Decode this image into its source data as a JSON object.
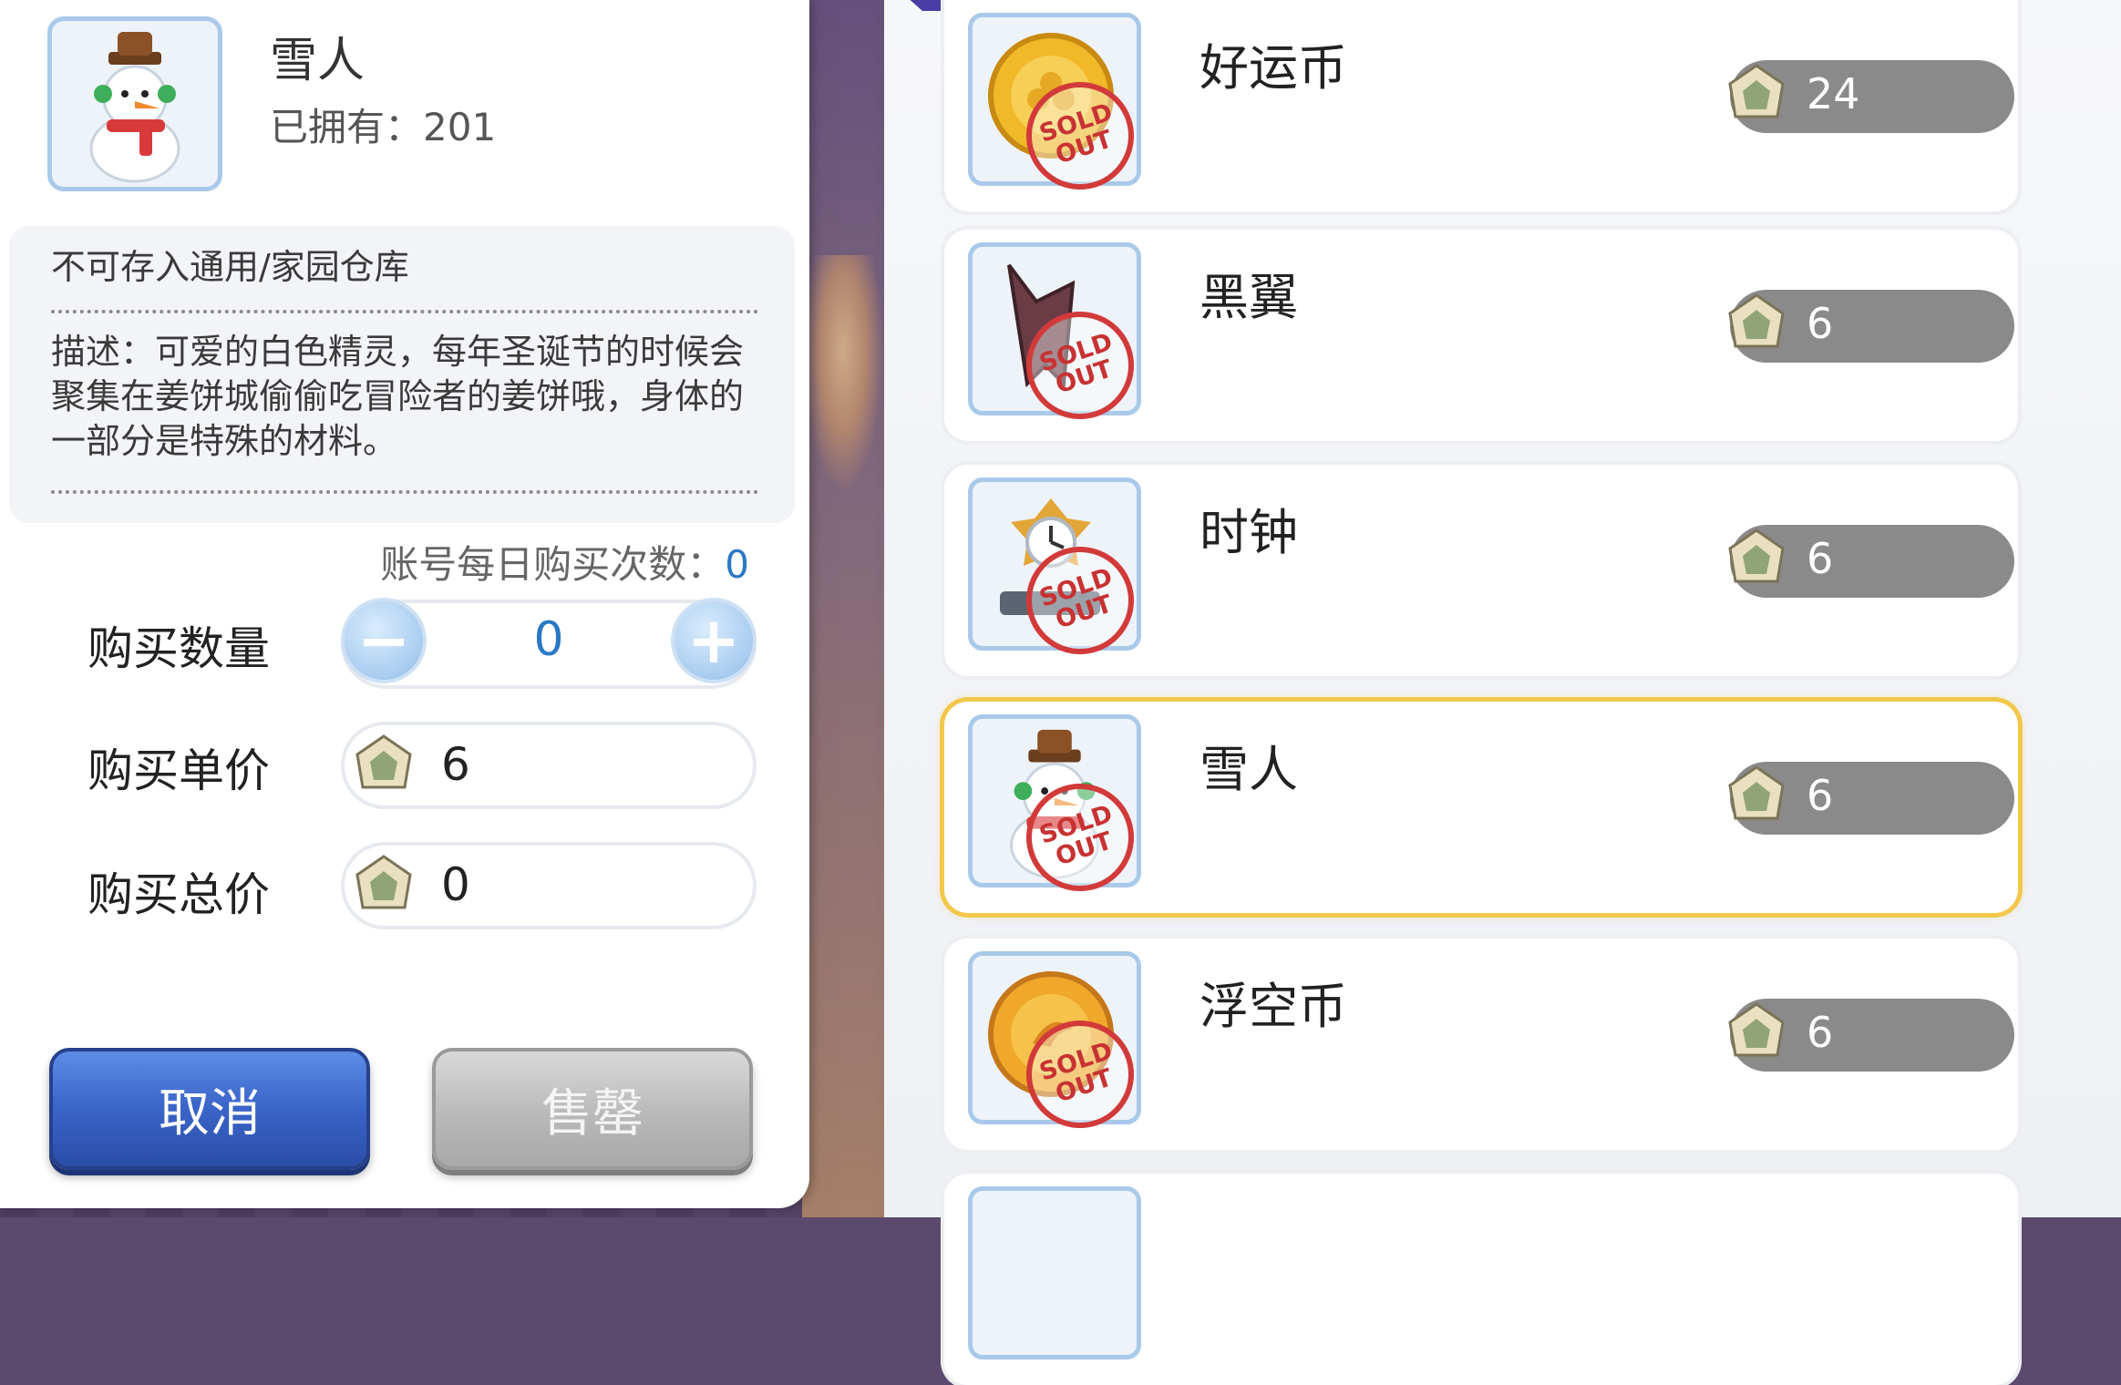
{
  "item": {
    "name": "雪人",
    "owned_label": "已拥有：201",
    "storage_note": "不可存入通用/家园仓库",
    "description": "描述：可爱的白色精灵，每年圣诞节的时候会聚集在姜饼城偷偷吃冒险者的姜饼哦，身体的一部分是特殊的材料。",
    "icon": "snowman-icon"
  },
  "daily": {
    "label": "账号每日购买次数：",
    "count": "0"
  },
  "form": {
    "qty_label": "购买数量",
    "qty_value": "0",
    "minus": "−",
    "plus": "+",
    "unit_label": "购买单价",
    "unit_value": "6",
    "total_label": "购买总价",
    "total_value": "0"
  },
  "buttons": {
    "cancel": "取消",
    "sell": "售罄"
  },
  "shop": {
    "sold_text": "SOLD OUT",
    "items": [
      {
        "name": "好运币",
        "price": "24",
        "icon": "lucky-coin-icon"
      },
      {
        "name": "黑翼",
        "price": "6",
        "icon": "black-wing-icon"
      },
      {
        "name": "时钟",
        "price": "6",
        "icon": "clock-icon"
      },
      {
        "name": "雪人",
        "price": "6",
        "icon": "snowman-icon",
        "selected": true
      },
      {
        "name": "浮空币",
        "price": "6",
        "icon": "floating-coin-icon"
      }
    ]
  },
  "colors": {
    "accent_blue": "#2a78c4",
    "cancel_blue": "#3a64c8",
    "sold_red": "#d23a3a",
    "selected_gold": "#f3c74a",
    "price_pill": "#8a8a8a"
  }
}
